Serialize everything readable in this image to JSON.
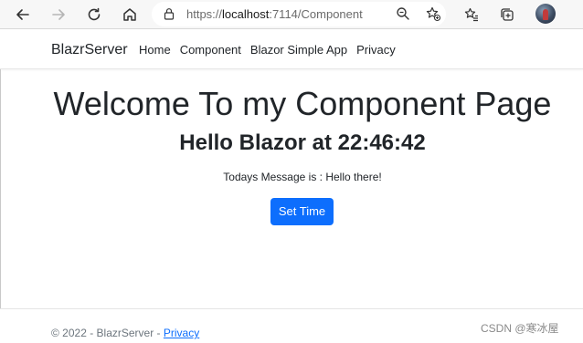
{
  "browser": {
    "url_scheme": "https://",
    "url_host": "localhost",
    "url_rest": ":7114/Component",
    "icons": [
      "back-arrow-icon",
      "forward-arrow-icon",
      "refresh-icon",
      "home-icon",
      "lock-icon",
      "zoom-icon",
      "favorite-add-icon",
      "favorites-icon",
      "collections-icon",
      "profile-avatar"
    ]
  },
  "navbar": {
    "brand": "BlazrServer",
    "links": [
      "Home",
      "Component",
      "Blazor Simple App",
      "Privacy"
    ]
  },
  "main": {
    "title": "Welcome To my Component Page",
    "hello": "Hello Blazor at 22:46:42",
    "message": "Todays Message is : Hello there!",
    "button_label": "Set Time"
  },
  "footer": {
    "copyright": "© 2022 - BlazrServer - ",
    "privacy_link": "Privacy",
    "watermark": "CSDN @寒冰屋"
  },
  "colors": {
    "primary": "#0d6efd",
    "text": "#212529",
    "muted": "#6c757d"
  }
}
